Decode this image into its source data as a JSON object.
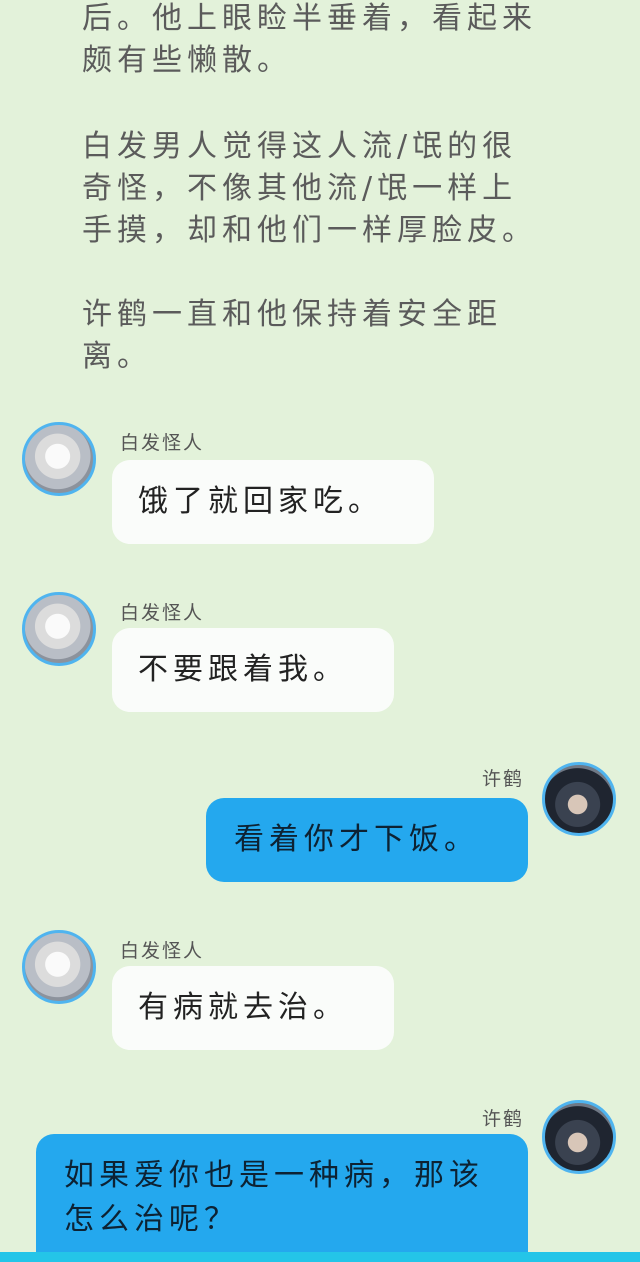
{
  "narration": [
    "后。他上眼睑半垂着，看起来颇有些懒散。",
    "白发男人觉得这人流/氓的很奇怪，不像其他流/氓一样上手摸，却和他们一样厚脸皮。",
    "许鹤一直和他保持着安全距离。"
  ],
  "characters": {
    "left_name": "白发怪人",
    "right_name": "许鹤"
  },
  "messages": [
    {
      "side": "left",
      "text": "饿了就回家吃。"
    },
    {
      "side": "left",
      "text": "不要跟着我。"
    },
    {
      "side": "right",
      "text": "看着你才下饭。"
    },
    {
      "side": "left",
      "text": "有病就去治。"
    },
    {
      "side": "right",
      "text": "如果爱你也是一种病，那该怎么治呢？"
    }
  ],
  "colors": {
    "background": "#e3f2da",
    "left_bubble": "#fafcfa",
    "right_bubble": "#24a8ee",
    "avatar_ring": "#4fb4ef"
  }
}
